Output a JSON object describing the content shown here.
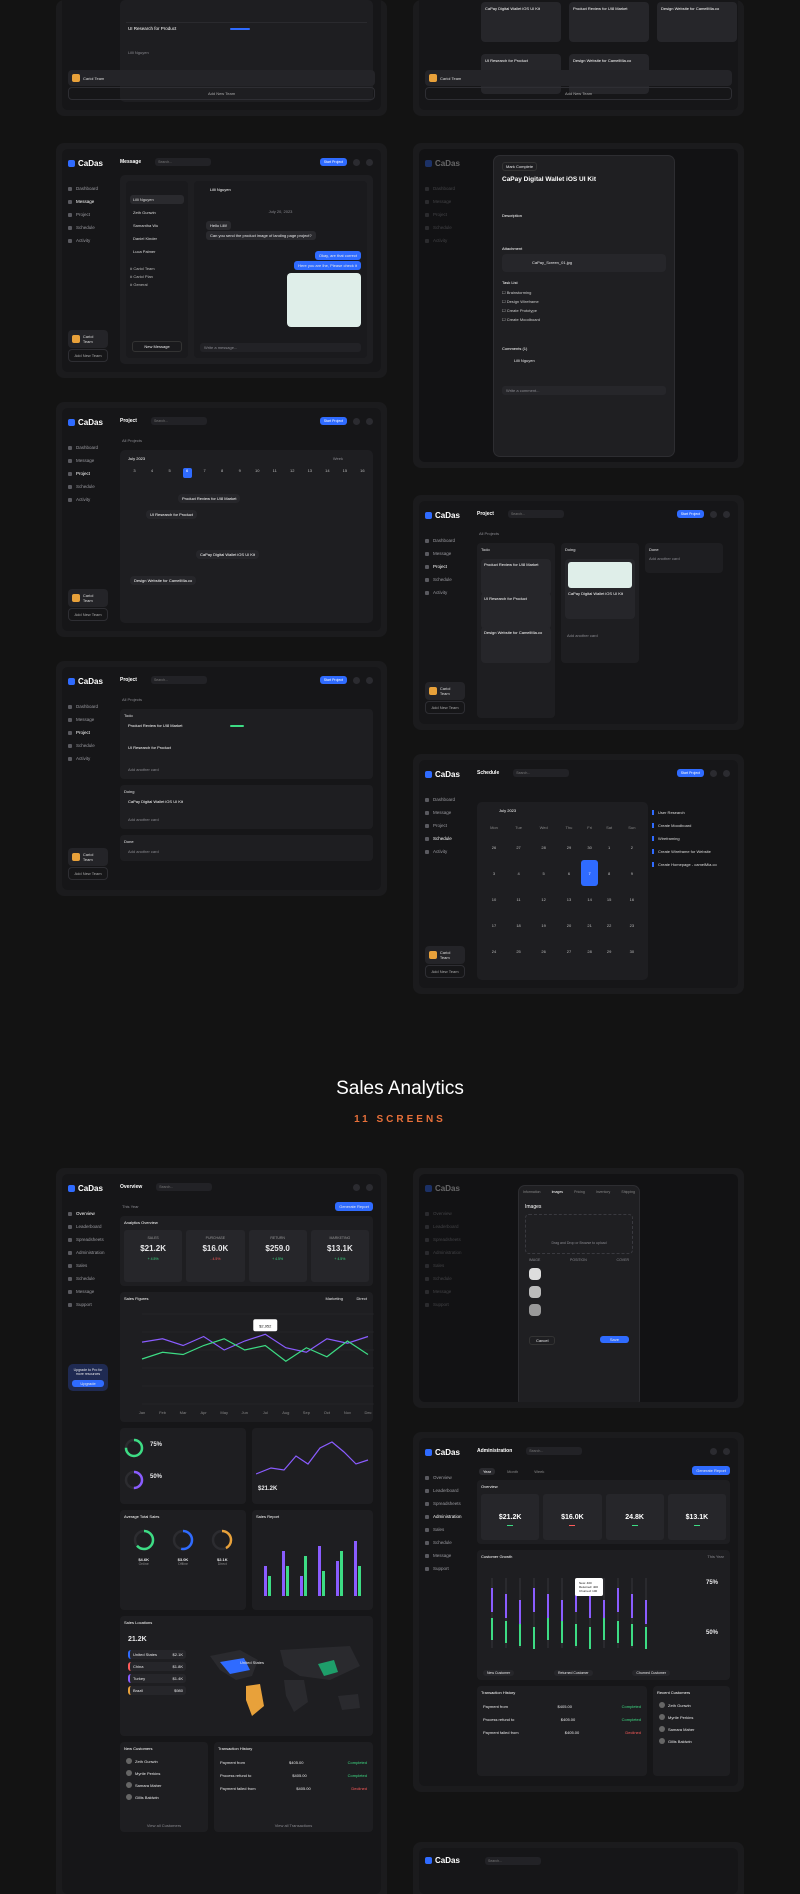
{
  "section": {
    "title": "Sales Analytics",
    "subtitle": "11 SCREENS"
  },
  "brand": "CaDas",
  "colors": {
    "accent": "#2f6bff",
    "orange": "#e8703a",
    "green": "#3ddc84",
    "red": "#ff5b5b",
    "purple": "#8a5cff",
    "background": "#131313"
  },
  "sidebar": {
    "items": [
      "Dashboard",
      "Message",
      "Project",
      "Schedule",
      "Activity"
    ],
    "team": "Cariol Team",
    "add_team": "Add New Team"
  },
  "sales_sidebar": {
    "items": [
      "Overview",
      "Leaderboard",
      "Spreadsheets",
      "Administration",
      "Sales",
      "Schedule"
    ],
    "extra": [
      "Message",
      "Support"
    ],
    "upgrade": "Upgrade to Pro for more resources",
    "upgrade_btn": "Upgrade"
  },
  "common": {
    "search": "Search...",
    "start_project": "Start Project",
    "generate_report": "Generate Report",
    "add_another_card": "Add another card",
    "new_message": "New Message",
    "write_message": "Write a message..."
  },
  "messages": {
    "title": "Message",
    "contact_active": "Lilli Nguyen",
    "contacts": [
      "Lilli Nguyen",
      "Zeth Gunwin",
      "Samantha Wu",
      "Daniel Kinder",
      "Luca Palmer"
    ],
    "groups": [
      "Cariol Team",
      "Cariol Plan",
      "General"
    ],
    "date": "July 20, 2023",
    "bubbles": [
      "Hello Lilli!",
      "Can you send the product image of landing page project?",
      "Okay, are that correct",
      "Here you are Ihe, Please check it"
    ]
  },
  "projects": {
    "title": "Project",
    "filter": "All Projects",
    "month": "July 2023",
    "week": "Week",
    "days": [
      "3",
      "4",
      "5",
      "6",
      "7",
      "8",
      "9",
      "10",
      "11",
      "12",
      "13",
      "14",
      "15",
      "16"
    ],
    "tasks": [
      "Product Review for UI8 Market",
      "UI Research for Product",
      "CaPay Digital Wallet iOS UI Kit",
      "Design Website for CamelMia.co"
    ],
    "columns": [
      "Todo",
      "Doing",
      "Done"
    ],
    "board_tasks": [
      "Product Review for UI8 Market",
      "UI Research for Product",
      "Design Website for CamelMia.co",
      "CaPay Digital Wallet iOS UI Kit"
    ]
  },
  "task_detail": {
    "title": "CaPay Digital Wallet iOS UI Kit",
    "mark_complete": "Mark Complete",
    "description": "Description",
    "attachment": "Attachment",
    "file": "CaPay_Screen_01.jpg",
    "task_list": "Task List",
    "subtasks": [
      "Brainstorming",
      "Design Wireframe",
      "Create Prototype",
      "Create Moodboard"
    ],
    "comments": "Comments (1)",
    "comment_author": "Lilli Nguyen",
    "write_comment": "Write a comment..."
  },
  "schedule": {
    "title": "Schedule",
    "month": "July 2023",
    "weekdays": [
      "Mon",
      "Tue",
      "Wed",
      "Thu",
      "Fri",
      "Sat",
      "Sun"
    ],
    "weeks": [
      [
        "26",
        "27",
        "28",
        "29",
        "30",
        "1",
        "2"
      ],
      [
        "3",
        "4",
        "5",
        "6",
        "7",
        "8",
        "9"
      ],
      [
        "10",
        "11",
        "12",
        "13",
        "14",
        "15",
        "16"
      ],
      [
        "17",
        "18",
        "19",
        "20",
        "21",
        "22",
        "23"
      ],
      [
        "24",
        "25",
        "26",
        "27",
        "28",
        "29",
        "30"
      ]
    ],
    "today": "7",
    "agenda": [
      "User Research",
      "Create Moodboard",
      "Wireframing",
      "Create Wireframe for Website",
      "Create Homepage - camelMia.co"
    ]
  },
  "overview": {
    "title": "Overview",
    "filter": "This Year",
    "section": "Analytics Overview",
    "kpis": [
      {
        "label": "SALES",
        "value": "$21.2K",
        "delta": "+ 4.5%",
        "up": true
      },
      {
        "label": "PURCHASE",
        "value": "$16.0K",
        "delta": "- 4.5%",
        "up": false
      },
      {
        "label": "RETURN",
        "value": "$259.0",
        "delta": "+ 4.5%",
        "up": true
      },
      {
        "label": "MARKETING",
        "value": "$13.1K",
        "delta": "+ 4.5%",
        "up": true
      }
    ],
    "sales_figures": "Sales Figures",
    "legend": [
      "Marketing",
      "Direct"
    ],
    "months": [
      "Jan",
      "Feb",
      "Mar",
      "Apr",
      "May",
      "Jun",
      "Jul",
      "Aug",
      "Sep",
      "Oct",
      "Nov",
      "Dec"
    ],
    "tooltip": "$2,952",
    "ring1": "75%",
    "ring2": "50%",
    "mini_value": "$21.2K",
    "avg_sales": "Average Total Sales",
    "sales_report": "Sales Report",
    "rings": [
      {
        "value": "$4.6K",
        "label": "Online"
      },
      {
        "value": "$3.0K",
        "label": "Offline"
      },
      {
        "value": "$2.1K",
        "label": "Direct"
      }
    ],
    "sales_locations": "Sales Locations",
    "loc_total": "21.2K",
    "countries": [
      {
        "name": "United States",
        "v": "$2.1K"
      },
      {
        "name": "China",
        "v": "$1.8K"
      },
      {
        "name": "Turkey",
        "v": "$1.4K"
      },
      {
        "name": "Brazil",
        "v": "$980"
      }
    ],
    "map_label": "United States",
    "new_customers": "New Customers",
    "customers": [
      "Zeth Gunwin",
      "Myrtle Perkins",
      "Samara Maher",
      "Gillis Baldwin"
    ],
    "transactions": "Transaction History",
    "tx": [
      {
        "name": "Payment from",
        "amt": "$405.00",
        "status": "Completed"
      },
      {
        "name": "Process refund to",
        "amt": "$405.00",
        "status": "Completed"
      },
      {
        "name": "Payment failed from",
        "amt": "$405.00",
        "status": "Declined"
      }
    ],
    "view_all_customers": "View all Customers",
    "view_all_tx": "View all Transactions"
  },
  "product_modal": {
    "tabs": [
      "Information",
      "Images",
      "Pricing",
      "Inventory",
      "Shipping"
    ],
    "active": "Images",
    "heading": "Images",
    "drop": "Drag and Drop or Browse to upload",
    "cols": [
      "IMAGE",
      "POSITION",
      "COVER"
    ],
    "cancel": "Cancel",
    "save": "Save"
  },
  "admin": {
    "title": "Administration",
    "tabs": [
      "Year",
      "Month",
      "Week"
    ],
    "overview": "Overview",
    "kpis": [
      "$21.2K",
      "$16.0K",
      "24.8K",
      "$13.1K"
    ],
    "growth": "Customer Growth",
    "growth_filter": "This Year",
    "tooltip_items": [
      "New: 400",
      "Returned: 400",
      "Churned: 100"
    ],
    "pct1": "75%",
    "pct2": "50%",
    "legend": [
      "New Customer",
      "Returned Customer",
      "Churned Customer"
    ],
    "tx_title": "Transaction History",
    "recent": "Recent Customers"
  }
}
